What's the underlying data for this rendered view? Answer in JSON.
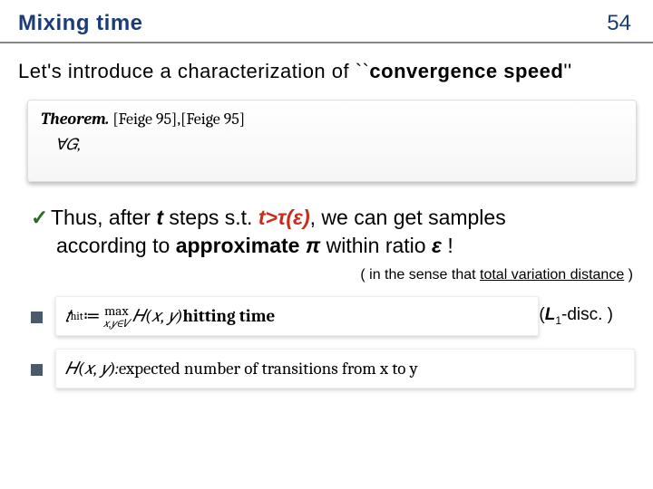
{
  "header": {
    "title": "Mixing time",
    "page_number": "54"
  },
  "intro": {
    "prefix": "Let's introduce a characterization of ``",
    "emph": "convergence speed",
    "suffix": "''"
  },
  "theorem": {
    "label": "Theorem.",
    "citations": " [Feige 95],[Feige 95]",
    "body": "∀𝐺,"
  },
  "bullet": {
    "mark": "✓",
    "t1": "Thus, after ",
    "it_t": "t",
    "t2": " steps s.t. ",
    "red_ineq": "t>τ(ε)",
    "t3": ", we can get samples",
    "t4": "according to ",
    "b_approx": "approximate ",
    "it_pi": "π",
    "t5": " within ratio ",
    "it_eps": "ε",
    "t6": " !"
  },
  "note": {
    "prefix": "( in the sense that ",
    "underlined": "total variation distance",
    "suffix": " )"
  },
  "defs": {
    "row1": {
      "t_hit": "𝑡",
      "hit_sub": "hit",
      "coloneq": " ≔ ",
      "max_top": "max",
      "max_bottom": "𝑥,𝑦∈𝑉",
      "H": " 𝐻(𝑥, 𝑦) ",
      "label": "hitting time"
    },
    "row2": {
      "lhs": "𝐻(𝑥, 𝑦): ",
      "rhs": "expected number of transitions from x to y"
    },
    "l1disc": {
      "open": "(",
      "L": "L",
      "sub": "1",
      "rest": "-disc. )"
    }
  }
}
